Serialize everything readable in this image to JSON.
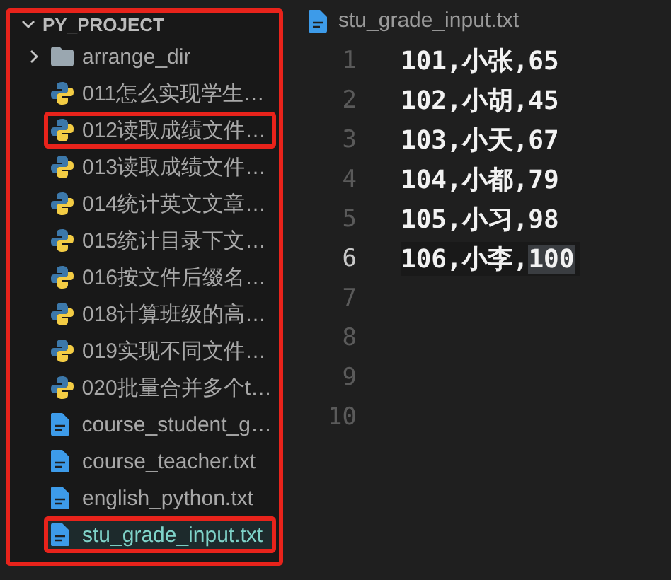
{
  "explorer": {
    "title": "PY_PROJECT",
    "expanded": true,
    "outlined": true,
    "items": [
      {
        "kind": "folder",
        "label": "arrange_dir",
        "expanded": false,
        "selected": false,
        "outlined": false
      },
      {
        "kind": "python",
        "label": "011怎么实现学生…",
        "selected": false,
        "outlined": false
      },
      {
        "kind": "python",
        "label": "012读取成绩文件…",
        "selected": false,
        "outlined": true
      },
      {
        "kind": "python",
        "label": "013读取成绩文件…",
        "selected": false,
        "outlined": false
      },
      {
        "kind": "python",
        "label": "014统计英文文章…",
        "selected": false,
        "outlined": false
      },
      {
        "kind": "python",
        "label": "015统计目录下文…",
        "selected": false,
        "outlined": false
      },
      {
        "kind": "python",
        "label": "016按文件后缀名…",
        "selected": false,
        "outlined": false
      },
      {
        "kind": "python",
        "label": "018计算班级的高…",
        "selected": false,
        "outlined": false
      },
      {
        "kind": "python",
        "label": "019实现不同文件…",
        "selected": false,
        "outlined": false
      },
      {
        "kind": "python",
        "label": "020批量合并多个t…",
        "selected": false,
        "outlined": false
      },
      {
        "kind": "text",
        "label": "course_student_g…",
        "selected": false,
        "outlined": false
      },
      {
        "kind": "text",
        "label": "course_teacher.txt",
        "selected": false,
        "outlined": false
      },
      {
        "kind": "text",
        "label": "english_python.txt",
        "selected": false,
        "outlined": false
      },
      {
        "kind": "text",
        "label": "stu_grade_input.txt",
        "selected": true,
        "outlined": true
      }
    ]
  },
  "editor": {
    "tab": {
      "label": "stu_grade_input.txt"
    },
    "lines": [
      {
        "number": "1",
        "text": "101,小张,65",
        "current": false
      },
      {
        "number": "2",
        "text": "102,小胡,45",
        "current": false
      },
      {
        "number": "3",
        "text": "103,小天,67",
        "current": false
      },
      {
        "number": "4",
        "text": "104,小都,79",
        "current": false
      },
      {
        "number": "5",
        "text": "105,小习,98",
        "current": false
      },
      {
        "number": "6",
        "text": "106,小李,",
        "selection": "100",
        "current": true
      },
      {
        "number": "7",
        "current": false
      },
      {
        "number": "8",
        "current": false
      },
      {
        "number": "9",
        "current": false
      },
      {
        "number": "10",
        "current": false
      }
    ]
  }
}
